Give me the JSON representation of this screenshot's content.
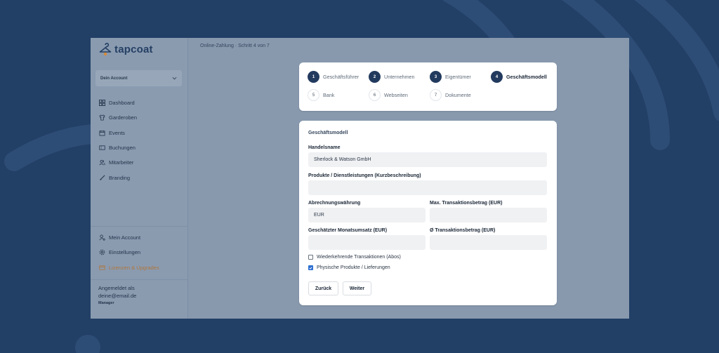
{
  "brand": {
    "name": "tapcoat"
  },
  "sidebar": {
    "account_select": "Dein Account",
    "nav": [
      {
        "icon": "dashboard-icon",
        "label": "Dashboard"
      },
      {
        "icon": "shirt-icon",
        "label": "Garderoben"
      },
      {
        "icon": "calendar-icon",
        "label": "Events"
      },
      {
        "icon": "ticket-icon",
        "label": "Buchungen"
      },
      {
        "icon": "users-icon",
        "label": "Mitarbeiter"
      },
      {
        "icon": "brush-icon",
        "label": "Branding"
      }
    ],
    "bottom_nav": [
      {
        "icon": "user-settings-icon",
        "label": "Mein Account"
      },
      {
        "icon": "gear-icon",
        "label": "Einstellungen"
      },
      {
        "icon": "license-icon",
        "label": "Lizenzen & Upgrades"
      }
    ],
    "login": {
      "label": "Angemeldet als",
      "email": "deine@email.de",
      "role": "Manager"
    }
  },
  "breadcrumb": "Online-Zahlung · Schritt 4 von 7",
  "steps": [
    {
      "num": "1",
      "label": "Geschäftsführer",
      "state": "done"
    },
    {
      "num": "2",
      "label": "Unternehmen",
      "state": "done"
    },
    {
      "num": "3",
      "label": "Eigentümer",
      "state": "done"
    },
    {
      "num": "4",
      "label": "Geschäftsmodell",
      "state": "active"
    },
    {
      "num": "5",
      "label": "Bank",
      "state": "todo"
    },
    {
      "num": "6",
      "label": "Webseiten",
      "state": "todo"
    },
    {
      "num": "7",
      "label": "Dokumente",
      "state": "todo"
    }
  ],
  "form": {
    "title": "Geschäftsmodell",
    "trade_name": {
      "label": "Handelsname",
      "value": "Sherlock & Watson GmbH"
    },
    "products": {
      "label": "Produkte / Dienstleistungen (Kurzbeschreibung)",
      "value": ""
    },
    "currency": {
      "label": "Abrechnungswährung",
      "value": "EUR"
    },
    "max_amount": {
      "label": "Max. Transaktionsbetrag (EUR)",
      "value": ""
    },
    "monthly": {
      "label": "Geschätzter Monatsumsatz (EUR)",
      "value": ""
    },
    "avg_amount": {
      "label": "Ø Transaktionsbetrag (EUR)",
      "value": ""
    },
    "recurring": {
      "label": "Wiederkehrende Transaktionen (Abos)",
      "checked": false
    },
    "physical": {
      "label": "Physische Produkte / Lieferungen",
      "checked": true
    },
    "back_label": "Zurück",
    "next_label": "Weiter"
  },
  "colors": {
    "background": "#223f66",
    "primary": "#223a5e",
    "accent": "#b0763a",
    "checkbox": "#2e6fd1"
  }
}
